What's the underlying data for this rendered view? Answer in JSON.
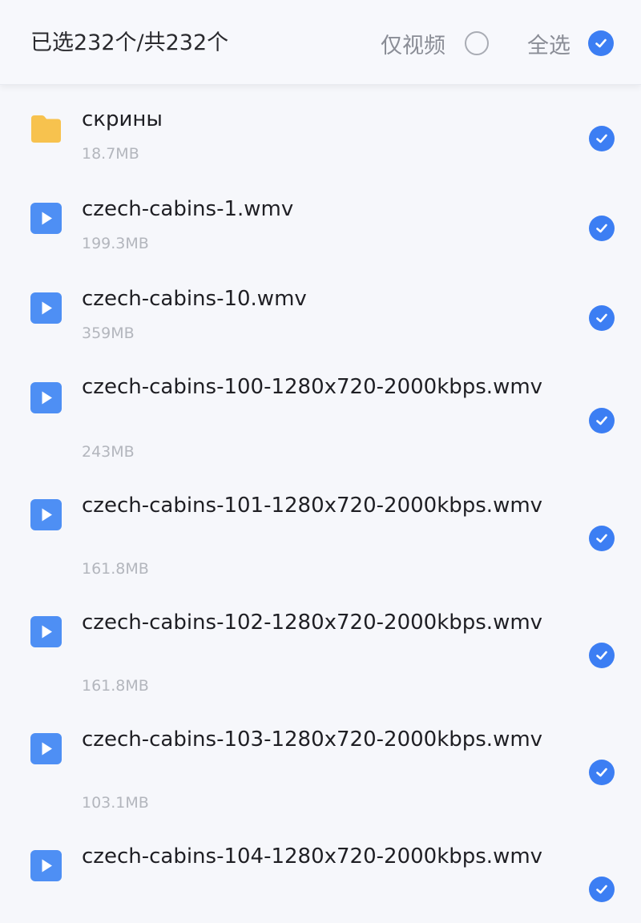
{
  "header": {
    "selected_count": "已选232个/共232个",
    "video_only_label": "仅视频",
    "select_all_label": "全选"
  },
  "colors": {
    "accent": "#3c7ef3",
    "folder": "#f7c24e",
    "video_icon": "#4e8ff4",
    "size_text": "#b3b6bd"
  },
  "files": [
    {
      "icon": "folder-icon",
      "name": "скрины",
      "size": "18.7MB",
      "selected": true
    },
    {
      "icon": "video-file-icon",
      "name": "czech-cabins-1.wmv",
      "size": "199.3MB",
      "selected": true
    },
    {
      "icon": "video-file-icon",
      "name": "czech-cabins-10.wmv",
      "size": "359MB",
      "selected": true
    },
    {
      "icon": "video-file-icon",
      "name": "czech-cabins-100-1280x720-2000kbps.wmv",
      "size": "243MB",
      "selected": true
    },
    {
      "icon": "video-file-icon",
      "name": "czech-cabins-101-1280x720-2000kbps.wmv",
      "size": "161.8MB",
      "selected": true
    },
    {
      "icon": "video-file-icon",
      "name": "czech-cabins-102-1280x720-2000kbps.wmv",
      "size": "161.8MB",
      "selected": true
    },
    {
      "icon": "video-file-icon",
      "name": "czech-cabins-103-1280x720-2000kbps.wmv",
      "size": "103.1MB",
      "selected": true
    },
    {
      "icon": "video-file-icon",
      "name": "czech-cabins-104-1280x720-2000kbps.wmv",
      "size": "",
      "selected": true
    }
  ]
}
